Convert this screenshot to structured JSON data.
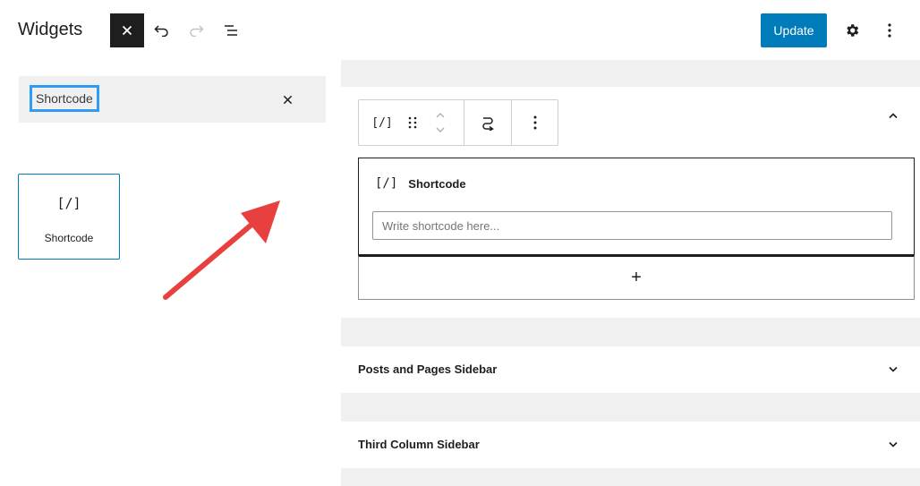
{
  "header": {
    "title": "Widgets",
    "update_label": "Update",
    "icons": [
      "close-icon",
      "undo-icon",
      "redo-icon",
      "list-view-icon",
      "gear-icon",
      "more-vertical-icon"
    ]
  },
  "inserter": {
    "search": {
      "value": "Shortcode"
    },
    "results": [
      {
        "icon": "[/]",
        "label": "Shortcode"
      }
    ]
  },
  "editor": {
    "shortcode_block": {
      "icon": "[/]",
      "title": "Shortcode",
      "placeholder": "Write shortcode here..."
    },
    "appender_symbol": "+",
    "widget_areas": [
      {
        "title": "Posts and Pages Sidebar"
      },
      {
        "title": "Third Column Sidebar"
      }
    ]
  },
  "colors": {
    "accent": "#007cba",
    "highlight": "#2e9cf4",
    "arrow": "#e8403f",
    "canvas_bg": "#f0f0f0"
  }
}
